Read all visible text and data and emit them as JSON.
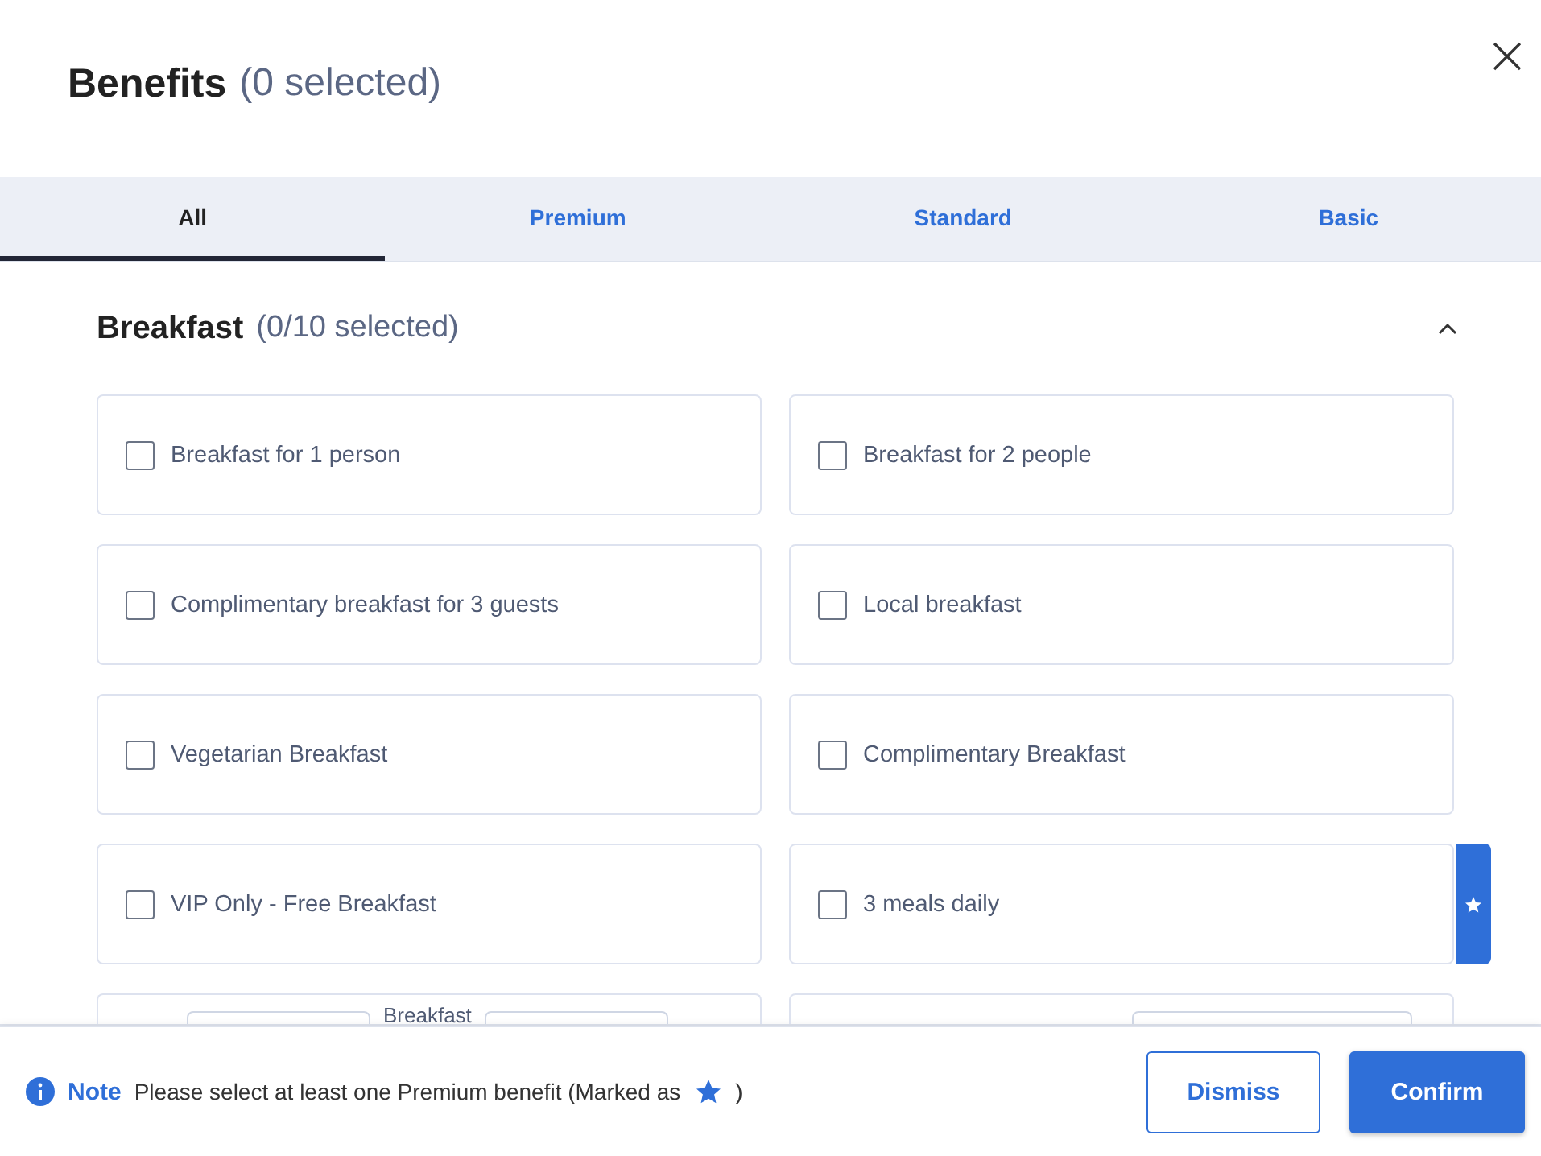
{
  "dialog": {
    "title": "Benefits",
    "count": "(0 selected)"
  },
  "tabs": [
    {
      "label": "All",
      "selected": true
    },
    {
      "label": "Premium",
      "selected": false
    },
    {
      "label": "Standard",
      "selected": false
    },
    {
      "label": "Basic",
      "selected": false
    }
  ],
  "section": {
    "title": "Breakfast",
    "count": "(0/10 selected)",
    "expanded": true,
    "items": [
      {
        "label": "Breakfast for 1 person",
        "checked": false,
        "premium": false
      },
      {
        "label": "Breakfast for 2 people",
        "checked": false,
        "premium": false
      },
      {
        "label": "Complimentary breakfast for 3 guests",
        "checked": false,
        "premium": false
      },
      {
        "label": "Local breakfast",
        "checked": false,
        "premium": false
      },
      {
        "label": "Vegetarian Breakfast",
        "checked": false,
        "premium": false
      },
      {
        "label": "Complimentary Breakfast",
        "checked": false,
        "premium": false
      },
      {
        "label": "VIP Only - Free Breakfast",
        "checked": false,
        "premium": false
      },
      {
        "label": "3 meals daily",
        "checked": false,
        "premium": true
      }
    ],
    "partial_items": [
      {
        "kind": "fields",
        "label": "Breakfast"
      },
      {
        "kind": "field"
      }
    ]
  },
  "footer": {
    "note_label": "Note",
    "note_text": "Please select at least one Premium benefit (Marked as",
    "note_end": ")",
    "buttons": [
      {
        "label": "Dismiss",
        "kind": "secondary"
      },
      {
        "label": "Confirm",
        "kind": "primary"
      }
    ]
  }
}
